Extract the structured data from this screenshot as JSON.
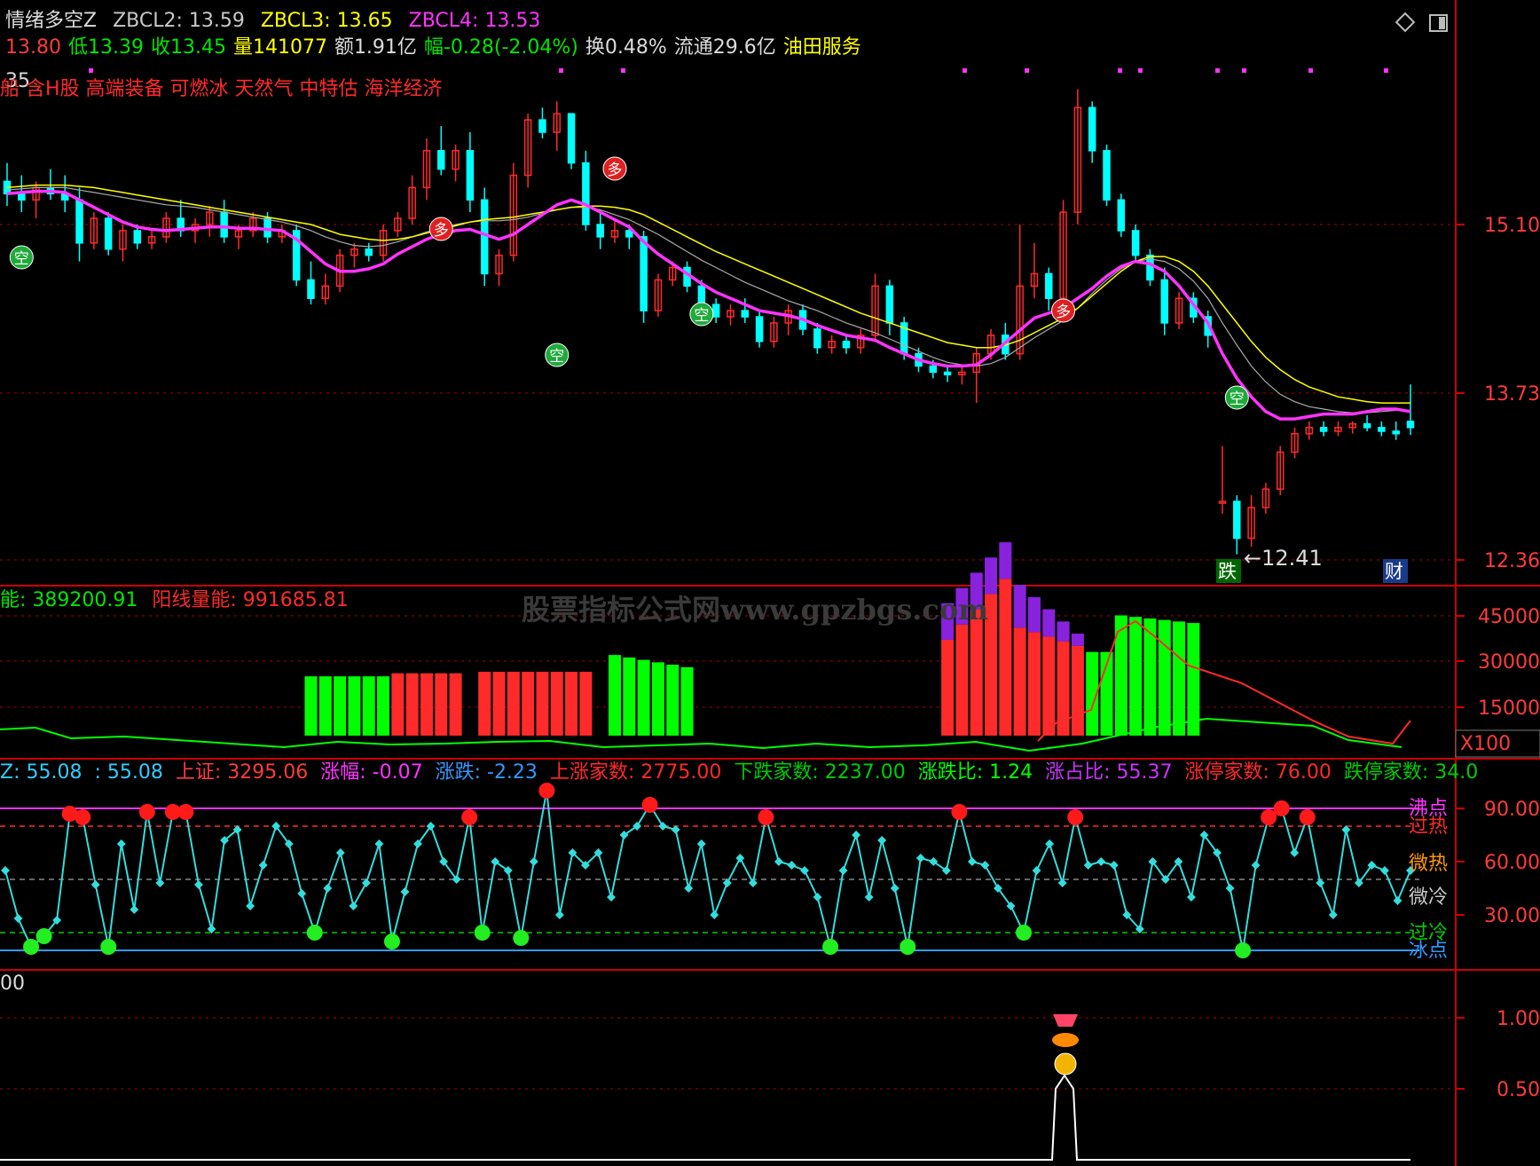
{
  "header": {
    "row1": [
      {
        "text": "情绪多空Z",
        "color": "#dcdcdc"
      },
      {
        "text": "ZBCL2: 13.59",
        "color": "#c8c8c8"
      },
      {
        "text": "ZBCL3: 13.65",
        "color": "#ffff00"
      },
      {
        "text": "ZBCL4: 13.53",
        "color": "#ff33ff"
      }
    ],
    "row2": [
      {
        "text": "13.80",
        "color": "#ff3b3b"
      },
      {
        "text": "低13.39",
        "color": "#00e600"
      },
      {
        "text": "收13.45",
        "color": "#00e600"
      },
      {
        "text": "量141077",
        "color": "#ffff00"
      },
      {
        "text": "额1.91亿",
        "color": "#dcdcdc"
      },
      {
        "text": "幅-0.28(-2.04%)",
        "color": "#00e600"
      },
      {
        "text": "换0.48%",
        "color": "#dcdcdc"
      },
      {
        "text": "流通29.6亿",
        "color": "#dcdcdc"
      },
      {
        "text": "油田服务",
        "color": "#ffff00"
      }
    ],
    "row3_num": "35",
    "concepts": "船 含H股 高端装备 可燃冰 天然气 中特估 海洋经济",
    "concepts_color": "#ff2a2a"
  },
  "price_panel": {
    "y_labels": [
      "15.10",
      "13.73",
      "12.36"
    ],
    "low_label": "←12.41",
    "badge_die": "跌",
    "badge_cai": "财"
  },
  "volume_panel": {
    "legend": [
      {
        "text": "能: 389200.91",
        "color": "#00e600"
      },
      {
        "text": "阳线量能: 991685.81",
        "color": "#ff2a2a"
      }
    ],
    "watermark": "股票指标公式网www.gpzbgs.com",
    "y_labels": [
      "45000",
      "30000",
      "15000"
    ],
    "unit": "X100"
  },
  "sentiment_panel": {
    "legend": [
      {
        "text": "Z: 55.08",
        "color": "#33ccff"
      },
      {
        "text": ": 55.08",
        "color": "#33ccff"
      },
      {
        "text": "上证: 3295.06",
        "color": "#ff3b3b"
      },
      {
        "text": "涨幅: -0.07",
        "color": "#ff33ff"
      },
      {
        "text": "涨跌: -2.23",
        "color": "#3399ff"
      },
      {
        "text": "上涨家数: 2775.00",
        "color": "#ff2a2a"
      },
      {
        "text": "下跌家数: 2237.00",
        "color": "#00cc00"
      },
      {
        "text": "涨跌比: 1.24",
        "color": "#00ff00"
      },
      {
        "text": "涨占比: 55.37",
        "color": "#cc33ff"
      },
      {
        "text": "涨停家数: 76.00",
        "color": "#ff2a2a"
      },
      {
        "text": "跌停家数: 34.0",
        "color": "#00cc00"
      }
    ],
    "y_labels": [
      "90.00",
      "60.00",
      "30.00"
    ],
    "zone_labels": [
      {
        "text": "沸点",
        "color": "#ff33ff"
      },
      {
        "text": "过热",
        "color": "#ff2a2a"
      },
      {
        "text": "微热",
        "color": "#ff9900"
      },
      {
        "text": "微冷",
        "color": "#c8c8c8"
      },
      {
        "text": "过冷",
        "color": "#00cc00"
      },
      {
        "text": "冰点",
        "color": "#3399ff"
      }
    ]
  },
  "signal_panel": {
    "legend": "00",
    "y_labels": [
      "1.00",
      "0.50"
    ]
  },
  "colors": {
    "up": "#ff2a2a",
    "down": "#00ffff",
    "ma": "#ff33ff",
    "ma2": "#ffff00",
    "ma3": "#aaaaaa",
    "grid": "#cc0000"
  },
  "chart_data": {
    "type": "line",
    "price_candles": [
      [
        15.45,
        15.6,
        15.25,
        15.35
      ],
      [
        15.35,
        15.5,
        15.2,
        15.3
      ],
      [
        15.3,
        15.45,
        15.15,
        15.4
      ],
      [
        15.4,
        15.55,
        15.3,
        15.35
      ],
      [
        15.35,
        15.5,
        15.2,
        15.3
      ],
      [
        15.3,
        15.4,
        14.8,
        14.95
      ],
      [
        14.95,
        15.2,
        14.9,
        15.15
      ],
      [
        15.15,
        15.2,
        14.85,
        14.9
      ],
      [
        14.9,
        15.1,
        14.8,
        15.05
      ],
      [
        15.05,
        15.1,
        14.9,
        14.95
      ],
      [
        14.95,
        15.05,
        14.9,
        15.0
      ],
      [
        15.0,
        15.2,
        14.95,
        15.15
      ],
      [
        15.15,
        15.3,
        15.0,
        15.05
      ],
      [
        15.05,
        15.15,
        14.95,
        15.1
      ],
      [
        15.1,
        15.25,
        15.0,
        15.2
      ],
      [
        15.2,
        15.3,
        14.95,
        15.0
      ],
      [
        15.0,
        15.1,
        14.9,
        15.05
      ],
      [
        15.05,
        15.2,
        15.0,
        15.15
      ],
      [
        15.15,
        15.2,
        14.95,
        15.0
      ],
      [
        15.0,
        15.1,
        14.95,
        15.05
      ],
      [
        15.05,
        15.1,
        14.6,
        14.65
      ],
      [
        14.65,
        14.8,
        14.45,
        14.5
      ],
      [
        14.5,
        14.7,
        14.45,
        14.6
      ],
      [
        14.6,
        14.9,
        14.55,
        14.85
      ],
      [
        14.85,
        14.95,
        14.75,
        14.9
      ],
      [
        14.9,
        14.95,
        14.8,
        14.85
      ],
      [
        14.85,
        15.1,
        14.8,
        15.05
      ],
      [
        15.05,
        15.2,
        15.0,
        15.15
      ],
      [
        15.15,
        15.5,
        15.1,
        15.4
      ],
      [
        15.4,
        15.8,
        15.3,
        15.7
      ],
      [
        15.7,
        15.9,
        15.5,
        15.55
      ],
      [
        15.55,
        15.75,
        15.45,
        15.7
      ],
      [
        15.7,
        15.85,
        15.2,
        15.3
      ],
      [
        15.3,
        15.4,
        14.6,
        14.7
      ],
      [
        14.7,
        14.9,
        14.6,
        14.85
      ],
      [
        14.85,
        15.6,
        14.8,
        15.5
      ],
      [
        15.5,
        16.0,
        15.4,
        15.95
      ],
      [
        15.95,
        16.05,
        15.8,
        15.85
      ],
      [
        15.85,
        16.1,
        15.7,
        16.0
      ],
      [
        16.0,
        16.0,
        15.55,
        15.6
      ],
      [
        15.6,
        15.7,
        15.05,
        15.1
      ],
      [
        15.1,
        15.2,
        14.9,
        15.0
      ],
      [
        15.0,
        15.15,
        14.95,
        15.05
      ],
      [
        15.05,
        15.1,
        14.9,
        15.0
      ],
      [
        15.0,
        15.05,
        14.3,
        14.4
      ],
      [
        14.4,
        14.7,
        14.35,
        14.65
      ],
      [
        14.65,
        14.8,
        14.6,
        14.75
      ],
      [
        14.75,
        14.8,
        14.55,
        14.6
      ],
      [
        14.6,
        14.65,
        14.4,
        14.45
      ],
      [
        14.45,
        14.5,
        14.3,
        14.35
      ],
      [
        14.35,
        14.45,
        14.28,
        14.4
      ],
      [
        14.4,
        14.5,
        14.3,
        14.35
      ],
      [
        14.35,
        14.4,
        14.1,
        14.15
      ],
      [
        14.15,
        14.35,
        14.1,
        14.3
      ],
      [
        14.3,
        14.45,
        14.2,
        14.4
      ],
      [
        14.4,
        14.45,
        14.2,
        14.25
      ],
      [
        14.25,
        14.3,
        14.05,
        14.1
      ],
      [
        14.1,
        14.2,
        14.05,
        14.15
      ],
      [
        14.15,
        14.2,
        14.05,
        14.1
      ],
      [
        14.1,
        14.25,
        14.05,
        14.2
      ],
      [
        14.2,
        14.7,
        14.15,
        14.6
      ],
      [
        14.6,
        14.65,
        14.2,
        14.3
      ],
      [
        14.3,
        14.35,
        14.0,
        14.05
      ],
      [
        14.05,
        14.1,
        13.9,
        13.95
      ],
      [
        13.95,
        14.0,
        13.85,
        13.9
      ],
      [
        13.9,
        13.95,
        13.82,
        13.88
      ],
      [
        13.88,
        13.95,
        13.8,
        13.9
      ],
      [
        13.9,
        14.1,
        13.65,
        14.05
      ],
      [
        14.05,
        14.25,
        14.0,
        14.2
      ],
      [
        14.2,
        14.3,
        14.0,
        14.05
      ],
      [
        14.05,
        15.1,
        14.0,
        14.6
      ],
      [
        14.6,
        14.95,
        14.5,
        14.7
      ],
      [
        14.7,
        14.75,
        14.4,
        14.5
      ],
      [
        14.5,
        15.3,
        14.45,
        15.2
      ],
      [
        15.2,
        16.2,
        15.1,
        16.05
      ],
      [
        16.05,
        16.1,
        15.6,
        15.7
      ],
      [
        15.7,
        15.75,
        15.25,
        15.3
      ],
      [
        15.3,
        15.35,
        15.0,
        15.05
      ],
      [
        15.05,
        15.1,
        14.8,
        14.85
      ],
      [
        14.85,
        14.9,
        14.6,
        14.65
      ],
      [
        14.65,
        14.75,
        14.2,
        14.3
      ],
      [
        14.3,
        14.55,
        14.25,
        14.5
      ],
      [
        14.5,
        14.55,
        14.3,
        14.35
      ],
      [
        14.35,
        14.4,
        14.1,
        14.2
      ],
      [
        12.85,
        13.3,
        12.75,
        12.85
      ],
      [
        12.85,
        12.9,
        12.42,
        12.55
      ],
      [
        12.55,
        12.9,
        12.48,
        12.8
      ],
      [
        12.8,
        13.0,
        12.75,
        12.95
      ],
      [
        12.95,
        13.3,
        12.9,
        13.25
      ],
      [
        13.25,
        13.45,
        13.2,
        13.4
      ],
      [
        13.4,
        13.5,
        13.35,
        13.45
      ],
      [
        13.45,
        13.5,
        13.38,
        13.42
      ],
      [
        13.42,
        13.5,
        13.38,
        13.45
      ],
      [
        13.45,
        13.5,
        13.4,
        13.48
      ],
      [
        13.48,
        13.55,
        13.42,
        13.45
      ],
      [
        13.45,
        13.5,
        13.38,
        13.42
      ],
      [
        13.42,
        13.5,
        13.35,
        13.4
      ],
      [
        13.5,
        13.8,
        13.39,
        13.45
      ]
    ],
    "ma_main": [
      15.35,
      15.36,
      15.37,
      15.37,
      15.36,
      15.3,
      15.24,
      15.18,
      15.12,
      15.08,
      15.06,
      15.05,
      15.06,
      15.07,
      15.08,
      15.08,
      15.07,
      15.07,
      15.06,
      15.05,
      14.98,
      14.88,
      14.78,
      14.72,
      14.72,
      14.74,
      14.78,
      14.86,
      14.92,
      14.98,
      15.02,
      15.05,
      15.06,
      15.02,
      14.98,
      15.02,
      15.1,
      15.18,
      15.26,
      15.3,
      15.26,
      15.2,
      15.14,
      15.08,
      14.96,
      14.86,
      14.78,
      14.7,
      14.62,
      14.55,
      14.5,
      14.45,
      14.4,
      14.38,
      14.36,
      14.33,
      14.28,
      14.24,
      14.2,
      14.18,
      14.16,
      14.1,
      14.05,
      14.0,
      13.97,
      13.95,
      13.95,
      13.96,
      14.04,
      14.14,
      14.24,
      14.34,
      14.38,
      14.42,
      14.5,
      14.58,
      14.68,
      14.76,
      14.8,
      14.78,
      14.72,
      14.6,
      14.45,
      14.3,
      14.05,
      13.85,
      13.7,
      13.58,
      13.52,
      13.52,
      13.54,
      13.56,
      13.56,
      13.56,
      13.58,
      13.6,
      13.6,
      13.58
    ],
    "ma2": [
      15.4,
      15.41,
      15.42,
      15.42,
      15.42,
      15.41,
      15.4,
      15.38,
      15.36,
      15.34,
      15.32,
      15.3,
      15.28,
      15.26,
      15.24,
      15.22,
      15.2,
      15.18,
      15.16,
      15.14,
      15.12,
      15.1,
      15.06,
      15.02,
      15.0,
      14.98,
      14.97,
      14.98,
      15.0,
      15.03,
      15.06,
      15.09,
      15.12,
      15.14,
      15.15,
      15.16,
      15.18,
      15.2,
      15.22,
      15.24,
      15.25,
      15.25,
      15.24,
      15.22,
      15.18,
      15.12,
      15.06,
      15.0,
      14.94,
      14.88,
      14.83,
      14.78,
      14.73,
      14.68,
      14.63,
      14.58,
      14.53,
      14.48,
      14.43,
      14.38,
      14.34,
      14.3,
      14.26,
      14.22,
      14.18,
      14.14,
      14.12,
      14.1,
      14.1,
      14.12,
      14.16,
      14.22,
      14.28,
      14.34,
      14.42,
      14.52,
      14.62,
      14.72,
      14.8,
      14.84,
      14.84,
      14.8,
      14.72,
      14.6,
      14.45,
      14.3,
      14.15,
      14.02,
      13.92,
      13.84,
      13.78,
      13.74,
      13.7,
      13.68,
      13.66,
      13.65,
      13.65,
      13.65
    ],
    "ma3": [
      15.38,
      15.39,
      15.4,
      15.4,
      15.4,
      15.38,
      15.36,
      15.34,
      15.32,
      15.3,
      15.28,
      15.26,
      15.25,
      15.24,
      15.22,
      15.2,
      15.18,
      15.16,
      15.14,
      15.12,
      15.09,
      15.05,
      15.0,
      14.96,
      14.93,
      14.92,
      14.93,
      14.96,
      15.0,
      15.04,
      15.07,
      15.1,
      15.12,
      15.13,
      15.13,
      15.14,
      15.16,
      15.19,
      15.22,
      15.24,
      15.24,
      15.22,
      15.18,
      15.14,
      15.08,
      15.02,
      14.95,
      14.88,
      14.81,
      14.75,
      14.69,
      14.63,
      14.58,
      14.53,
      14.48,
      14.44,
      14.4,
      14.35,
      14.3,
      14.26,
      14.22,
      14.17,
      14.12,
      14.07,
      14.02,
      13.98,
      13.96,
      13.95,
      13.97,
      14.02,
      14.1,
      14.18,
      14.25,
      14.32,
      14.42,
      14.54,
      14.65,
      14.74,
      14.8,
      14.82,
      14.8,
      14.74,
      14.64,
      14.5,
      14.3,
      14.12,
      13.95,
      13.82,
      13.72,
      13.66,
      13.62,
      13.6,
      13.58,
      13.57,
      13.57,
      13.58,
      13.59,
      13.59
    ],
    "sentiment": [
      55,
      28,
      12,
      18,
      27,
      87,
      85,
      47,
      12,
      70,
      33,
      88,
      48,
      88,
      88,
      47,
      22,
      72,
      78,
      35,
      58,
      80,
      70,
      42,
      20,
      45,
      65,
      35,
      48,
      70,
      15,
      43,
      70,
      80,
      60,
      50,
      85,
      20,
      60,
      55,
      17,
      60,
      100,
      30,
      65,
      58,
      65,
      40,
      75,
      80,
      92,
      80,
      78,
      45,
      70,
      30,
      48,
      62,
      48,
      85,
      60,
      58,
      55,
      40,
      12,
      55,
      75,
      40,
      72,
      45,
      12,
      62,
      60,
      55,
      88,
      60,
      58,
      45,
      35,
      20,
      55,
      70,
      48,
      85,
      58,
      60,
      58,
      30,
      22,
      60,
      50,
      60,
      40,
      75,
      65,
      45,
      10,
      58,
      85,
      90,
      65,
      85,
      48,
      30,
      78,
      48,
      58,
      55,
      38,
      55
    ]
  }
}
